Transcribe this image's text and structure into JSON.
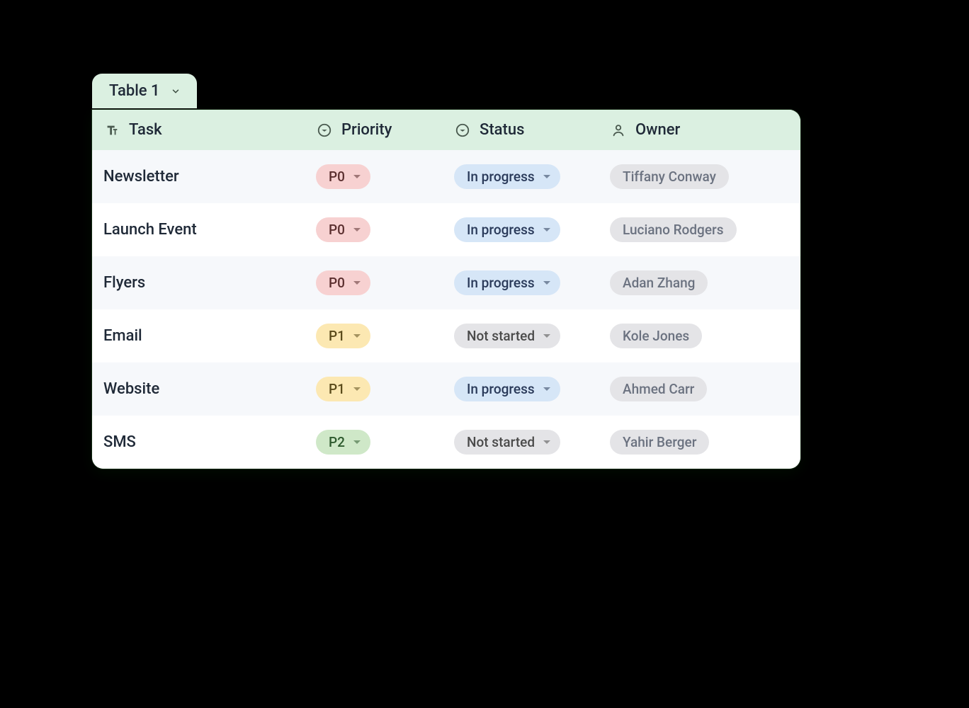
{
  "tab": {
    "label": "Table 1"
  },
  "columns": {
    "task": "Task",
    "priority": "Priority",
    "status": "Status",
    "owner": "Owner"
  },
  "rows": [
    {
      "task": "Newsletter",
      "priority": "P0",
      "priority_class": "p0",
      "status": "In progress",
      "status_class": "inprogress",
      "owner": "Tiffany Conway"
    },
    {
      "task": "Launch Event",
      "priority": "P0",
      "priority_class": "p0",
      "status": "In progress",
      "status_class": "inprogress",
      "owner": "Luciano Rodgers"
    },
    {
      "task": "Flyers",
      "priority": "P0",
      "priority_class": "p0",
      "status": "In progress",
      "status_class": "inprogress",
      "owner": "Adan Zhang"
    },
    {
      "task": "Email",
      "priority": "P1",
      "priority_class": "p1",
      "status": "Not started",
      "status_class": "notstarted",
      "owner": "Kole Jones"
    },
    {
      "task": "Website",
      "priority": "P1",
      "priority_class": "p1",
      "status": "In progress",
      "status_class": "inprogress",
      "owner": "Ahmed Carr"
    },
    {
      "task": "SMS",
      "priority": "P2",
      "priority_class": "p2",
      "status": "Not started",
      "status_class": "notstarted",
      "owner": "Yahir Berger"
    }
  ]
}
